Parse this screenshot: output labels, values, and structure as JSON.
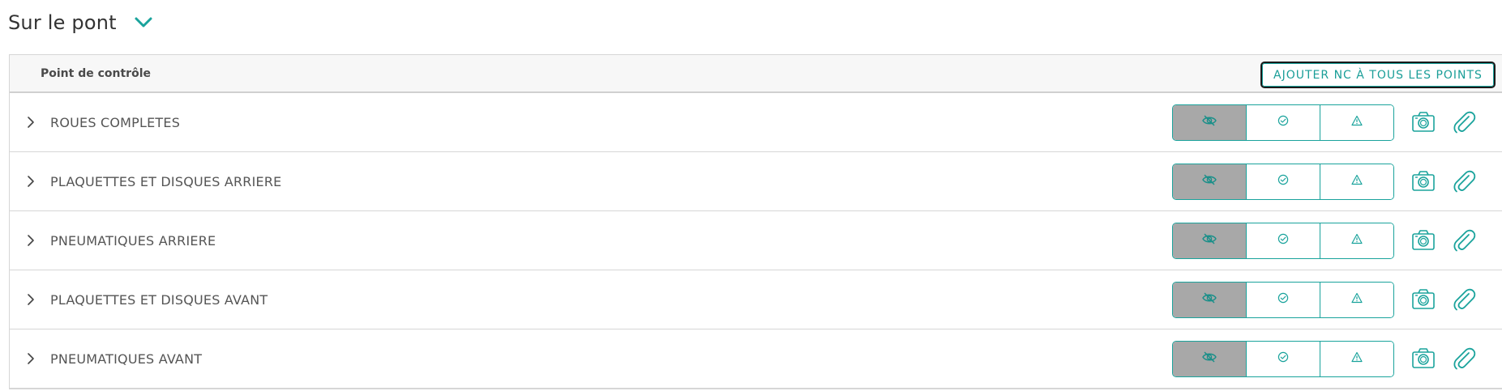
{
  "section": {
    "title": "Sur le pont",
    "toggle_icon": "chevron-down-icon"
  },
  "table": {
    "column_label": "Point de contrôle",
    "add_nc_label": "AJOUTER NC À TOUS LES POINTS",
    "rows": [
      {
        "label": "ROUES COMPLETES",
        "status": "hidden"
      },
      {
        "label": "PLAQUETTES ET DISQUES ARRIERE",
        "status": "hidden"
      },
      {
        "label": "PNEUMATIQUES ARRIERE",
        "status": "hidden"
      },
      {
        "label": "PLAQUETTES ET DISQUES AVANT",
        "status": "hidden"
      },
      {
        "label": "PNEUMATIQUES AVANT",
        "status": "hidden"
      }
    ],
    "row_icons": {
      "expand": "chevron-right-icon",
      "status_options": [
        "eye-off-icon",
        "check-circle-icon",
        "warning-icon"
      ],
      "photo": "camera-icon",
      "attachment": "paperclip-icon"
    }
  },
  "colors": {
    "accent": "#1aa39c",
    "active_status_bg": "#a8a8a8",
    "header_bg": "#f7f7f7",
    "border": "#d6d6d6"
  }
}
